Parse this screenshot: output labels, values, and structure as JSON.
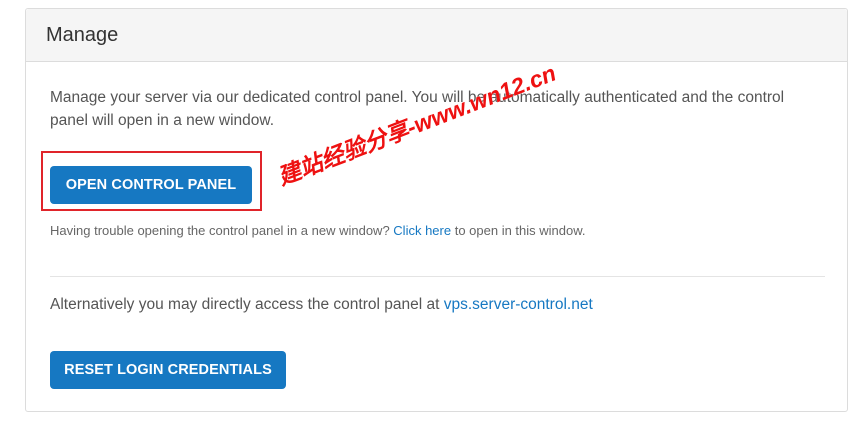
{
  "panel": {
    "title": "Manage"
  },
  "intro_text": "Manage your server via our dedicated control panel. You will be automatically authenticated and the control panel will open in a new window.",
  "open_button_label": "OPEN CONTROL PANEL",
  "trouble": {
    "prefix": "Having trouble opening the control panel in a new window?",
    "link_text": "Click here",
    "suffix": "to open in this window."
  },
  "alternative": {
    "prefix": "Alternatively you may directly access the control panel at",
    "link_text": "vps.server-control.net"
  },
  "reset_button_label": "RESET LOGIN CREDENTIALS",
  "watermark_text": "建站经验分享-www.wn12.cn",
  "colors": {
    "primary": "#1678c2",
    "highlight_border": "#e0242a",
    "watermark": "#ee1111"
  }
}
